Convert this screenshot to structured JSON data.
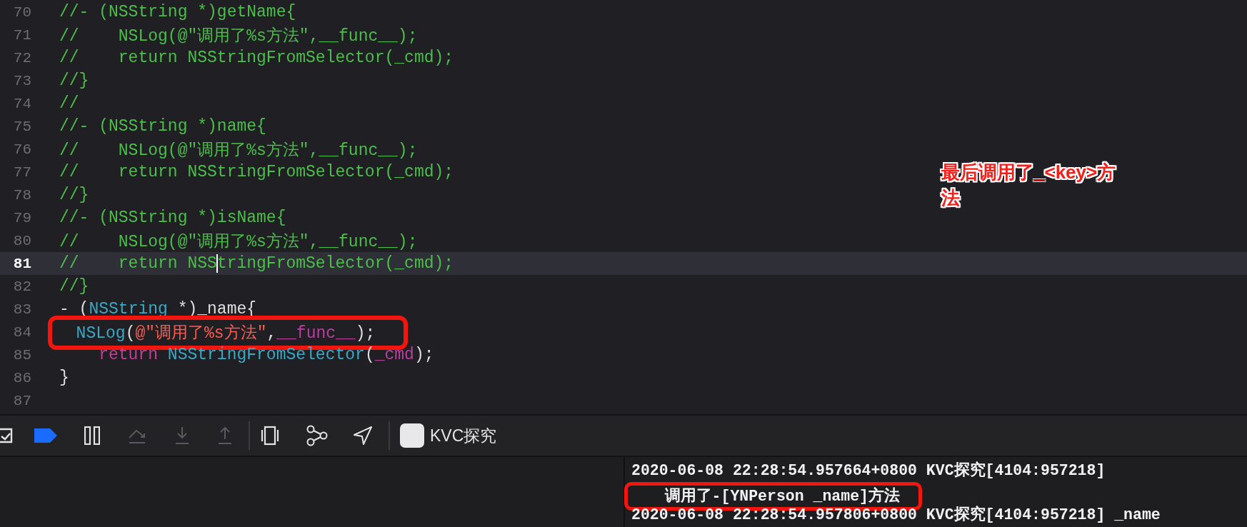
{
  "editor": {
    "lines": [
      {
        "number": "70",
        "current": false,
        "tokens": [
          {
            "kind": "comment",
            "text": "//- (NSString *)getName{"
          }
        ]
      },
      {
        "number": "71",
        "current": false,
        "tokens": [
          {
            "kind": "comment",
            "text": "//    NSLog(@\"调用了%s方法\",__func__);"
          }
        ]
      },
      {
        "number": "72",
        "current": false,
        "tokens": [
          {
            "kind": "comment",
            "text": "//    return NSStringFromSelector(_cmd);"
          }
        ]
      },
      {
        "number": "73",
        "current": false,
        "tokens": [
          {
            "kind": "comment",
            "text": "//}"
          }
        ]
      },
      {
        "number": "74",
        "current": false,
        "tokens": [
          {
            "kind": "comment",
            "text": "//"
          }
        ]
      },
      {
        "number": "75",
        "current": false,
        "tokens": [
          {
            "kind": "comment",
            "text": "//- (NSString *)name{"
          }
        ]
      },
      {
        "number": "76",
        "current": false,
        "tokens": [
          {
            "kind": "comment",
            "text": "//    NSLog(@\"调用了%s方法\",__func__);"
          }
        ]
      },
      {
        "number": "77",
        "current": false,
        "tokens": [
          {
            "kind": "comment",
            "text": "//    return NSStringFromSelector(_cmd);"
          }
        ]
      },
      {
        "number": "78",
        "current": false,
        "tokens": [
          {
            "kind": "comment",
            "text": "//}"
          }
        ]
      },
      {
        "number": "79",
        "current": false,
        "tokens": [
          {
            "kind": "comment",
            "text": "//- (NSString *)isName{"
          }
        ]
      },
      {
        "number": "80",
        "current": false,
        "tokens": [
          {
            "kind": "comment",
            "text": "//    NSLog(@\"调用了%s方法\",__func__);"
          }
        ]
      },
      {
        "number": "81",
        "current": true,
        "tokens": [
          {
            "kind": "comment",
            "text": "//    return NSS"
          },
          {
            "kind": "caret"
          },
          {
            "kind": "comment",
            "text": "tringFromSelector(_cmd);"
          }
        ]
      },
      {
        "number": "82",
        "current": false,
        "tokens": [
          {
            "kind": "comment",
            "text": "//}"
          }
        ]
      },
      {
        "number": "83",
        "current": false,
        "tokens": [
          {
            "kind": "plain",
            "text": "- ("
          },
          {
            "kind": "type",
            "text": "NSString"
          },
          {
            "kind": "plain",
            "text": " *)_name{"
          }
        ]
      },
      {
        "number": "84",
        "current": false,
        "boxed": true,
        "tokens": [
          {
            "kind": "type",
            "text": "  NSLog"
          },
          {
            "kind": "plain",
            "text": "("
          },
          {
            "kind": "string",
            "text": "@\"调用了%s方法\""
          },
          {
            "kind": "plain",
            "text": ","
          },
          {
            "kind": "macro",
            "text": "__func__"
          },
          {
            "kind": "plain",
            "text": ");"
          }
        ]
      },
      {
        "number": "85",
        "current": false,
        "tokens": [
          {
            "kind": "keyword",
            "text": "    return"
          },
          {
            "kind": "type",
            "text": " NSStringFromSelector"
          },
          {
            "kind": "plain",
            "text": "("
          },
          {
            "kind": "macro",
            "text": "_cmd"
          },
          {
            "kind": "plain",
            "text": ");"
          }
        ]
      },
      {
        "number": "86",
        "current": false,
        "tokens": [
          {
            "kind": "plain",
            "text": "}"
          }
        ]
      },
      {
        "number": "87",
        "current": false
      }
    ]
  },
  "annotation": {
    "text": "最后调用了_<key>方法"
  },
  "toolbar": {
    "buttons": [
      {
        "kind": "console-toggle",
        "disabled": false,
        "on": false
      },
      {
        "kind": "breakpoints",
        "disabled": false,
        "on": true
      },
      {
        "kind": "pause",
        "disabled": false,
        "on": false
      },
      {
        "kind": "step-over",
        "disabled": true,
        "on": false
      },
      {
        "kind": "step-into",
        "disabled": true,
        "on": false
      },
      {
        "kind": "step-out",
        "disabled": true,
        "on": false
      },
      {
        "kind": "view-debugger",
        "disabled": false,
        "on": false
      },
      {
        "kind": "memory-graph",
        "disabled": false,
        "on": false
      },
      {
        "kind": "location",
        "disabled": false,
        "on": false
      }
    ],
    "target": "KVC探究"
  },
  "console": {
    "lines": [
      {
        "text": "2020-06-08 22:28:54.957664+0800 KVC探究[4104:957218]",
        "boxed": false
      },
      {
        "text": "    调用了-[YNPerson _name]方法",
        "boxed": true
      },
      {
        "text": "2020-06-08 22:28:54.957806+0800 KVC探究[4104:957218] _name",
        "boxed": false
      }
    ]
  }
}
